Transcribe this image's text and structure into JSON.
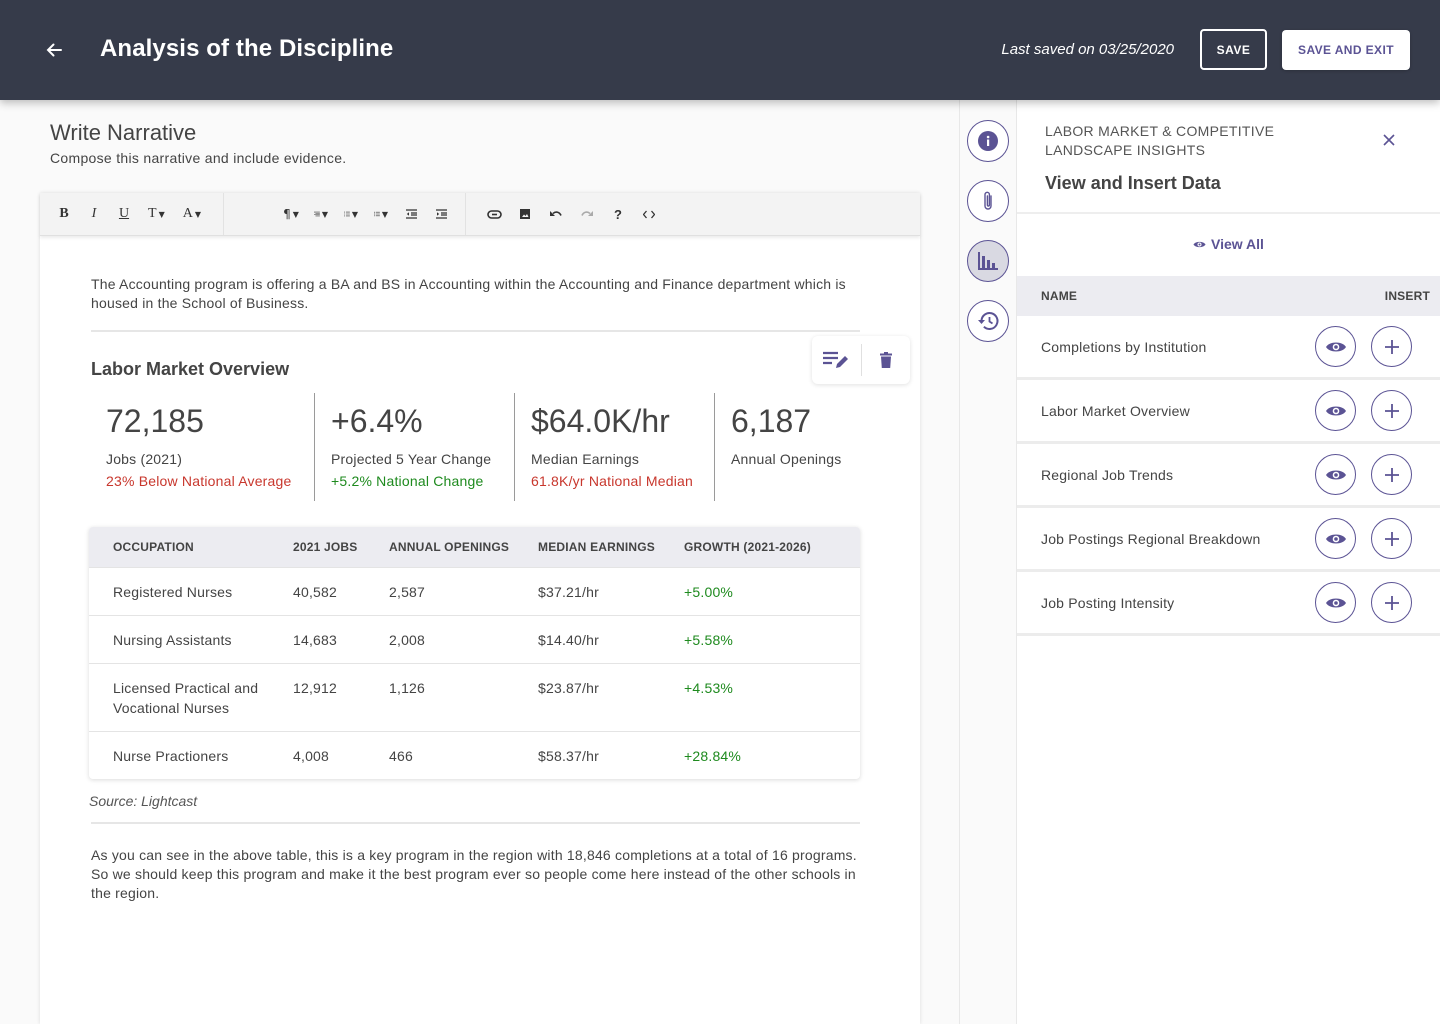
{
  "header": {
    "title": "Analysis of the Discipline",
    "last_saved": "Last saved on 03/25/2020",
    "save_label": "SAVE",
    "save_exit_label": "SAVE AND EXIT",
    "back_icon": "arrow-left-icon"
  },
  "section": {
    "title": "Write Narrative",
    "subtitle": "Compose this narrative and include evidence."
  },
  "toolbar": {
    "buttons": [
      {
        "name": "bold",
        "glyph": "B"
      },
      {
        "name": "italic",
        "glyph": "I"
      },
      {
        "name": "underline",
        "glyph": "U"
      },
      {
        "name": "font-size",
        "glyph": "T"
      },
      {
        "name": "font-color",
        "glyph": "A"
      },
      {
        "name": "paragraph-format",
        "glyph": "¶"
      },
      {
        "name": "align",
        "glyph": "align"
      },
      {
        "name": "ordered-list",
        "glyph": "ol"
      },
      {
        "name": "unordered-list",
        "glyph": "ul"
      },
      {
        "name": "outdent",
        "glyph": "outdent"
      },
      {
        "name": "indent",
        "glyph": "indent"
      },
      {
        "name": "link",
        "glyph": "link"
      },
      {
        "name": "image",
        "glyph": "image"
      },
      {
        "name": "undo",
        "glyph": "undo"
      },
      {
        "name": "redo",
        "glyph": "redo"
      },
      {
        "name": "help",
        "glyph": "?"
      },
      {
        "name": "code-view",
        "glyph": "<>"
      }
    ]
  },
  "editor": {
    "intro": "The Accounting program is offering a BA and BS in Accounting within the Accounting and Finance department which is housed in the School of Business.",
    "widget_title": "Labor Market Overview",
    "stats": [
      {
        "value": "72,185",
        "label": "Jobs (2021)",
        "note": "23% Below National Average",
        "note_tone": "negative"
      },
      {
        "value": "+6.4%",
        "label": "Projected 5 Year Change",
        "note": "+5.2% National Change",
        "note_tone": "positive"
      },
      {
        "value": "$64.0K/hr",
        "label": "Median Earnings",
        "note": "61.8K/yr National Median",
        "note_tone": "negative"
      },
      {
        "value": "6,187",
        "label": "Annual Openings",
        "note": "",
        "note_tone": ""
      }
    ],
    "table": {
      "columns": [
        "OCCUPATION",
        "2021 JOBS",
        "ANNUAL OPENINGS",
        "MEDIAN EARNINGS",
        "GROWTH (2021-2026)"
      ],
      "rows": [
        [
          "Registered Nurses",
          "40,582",
          "2,587",
          "$37.21/hr",
          "+5.00%"
        ],
        [
          "Nursing Assistants",
          "14,683",
          "2,008",
          "$14.40/hr",
          "+5.58%"
        ],
        [
          "Licensed Practical and Vocational Nurses",
          "12,912",
          "1,126",
          "$23.87/hr",
          "+4.53%"
        ],
        [
          "Nurse Practioners",
          "4,008",
          "466",
          "$58.37/hr",
          "+28.84%"
        ]
      ]
    },
    "source": "Source: Lightcast",
    "closing": "As you can see in the above table, this is a key program in the region with 18,846 completions at a total of 16 programs. So we should keep this program and make it the best program ever so people come here instead of the other schools in the region."
  },
  "rail": {
    "items": [
      {
        "name": "info",
        "icon": "info-icon",
        "active": false
      },
      {
        "name": "attachments",
        "icon": "paperclip-icon",
        "active": false
      },
      {
        "name": "data",
        "icon": "bar-chart-icon",
        "active": true
      },
      {
        "name": "history",
        "icon": "history-icon",
        "active": false
      }
    ]
  },
  "panel": {
    "eyebrow": "LABOR MARKET & COMPETITIVE LANDSCAPE INSIGHTS",
    "title": "View and Insert Data",
    "view_all": "View All",
    "col_name": "NAME",
    "col_insert": "INSERT",
    "items": [
      {
        "name": "Completions by Institution"
      },
      {
        "name": "Labor Market Overview"
      },
      {
        "name": "Regional Job Trends"
      },
      {
        "name": "Job Postings Regional Breakdown"
      },
      {
        "name": "Job Posting Intensity"
      }
    ]
  },
  "colors": {
    "header_bg": "#363b4a",
    "accent": "#5b5394",
    "negative": "#c8372d",
    "positive": "#1e8a1e"
  }
}
